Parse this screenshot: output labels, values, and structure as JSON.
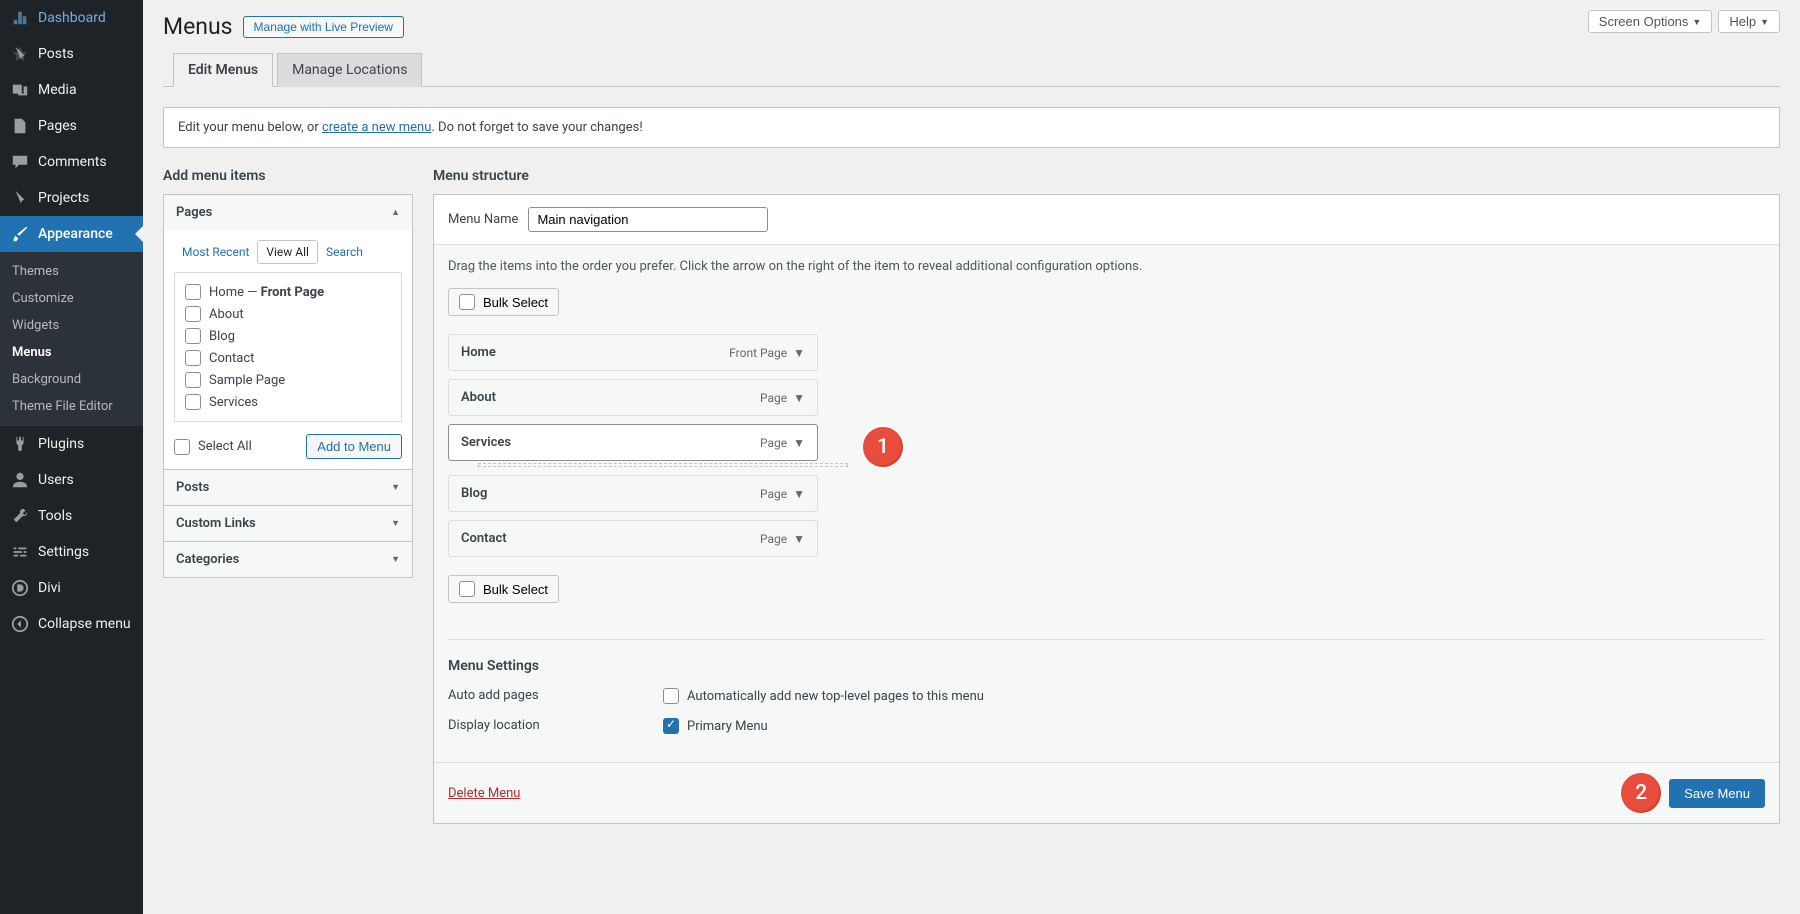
{
  "topControls": {
    "screenOptions": "Screen Options",
    "help": "Help"
  },
  "pageTitle": "Menus",
  "livePreviewBtn": "Manage with Live Preview",
  "tabs": {
    "editMenus": "Edit Menus",
    "manageLocations": "Manage Locations"
  },
  "infoBar": {
    "prefix": "Edit your menu below, or ",
    "link": "create a new menu",
    "suffix": ". Do not forget to save your changes!"
  },
  "sidebar": {
    "items": [
      {
        "label": "Dashboard"
      },
      {
        "label": "Posts"
      },
      {
        "label": "Media"
      },
      {
        "label": "Pages"
      },
      {
        "label": "Comments"
      },
      {
        "label": "Projects"
      },
      {
        "label": "Appearance"
      },
      {
        "label": "Plugins"
      },
      {
        "label": "Users"
      },
      {
        "label": "Tools"
      },
      {
        "label": "Settings"
      },
      {
        "label": "Divi"
      },
      {
        "label": "Collapse menu"
      }
    ],
    "submenu": {
      "themes": "Themes",
      "customize": "Customize",
      "widgets": "Widgets",
      "menus": "Menus",
      "background": "Background",
      "themeFileEditor": "Theme File Editor"
    }
  },
  "leftCol": {
    "title": "Add menu items",
    "pagesHeader": "Pages",
    "innerTabs": {
      "mostRecent": "Most Recent",
      "viewAll": "View All",
      "search": "Search"
    },
    "pagesList": {
      "home": "Home — ",
      "homeSuffix": "Front Page",
      "about": "About",
      "blog": "Blog",
      "contact": "Contact",
      "sample": "Sample Page",
      "services": "Services"
    },
    "selectAll": "Select All",
    "addToMenu": "Add to Menu",
    "postsHeader": "Posts",
    "customLinksHeader": "Custom Links",
    "categoriesHeader": "Categories"
  },
  "rightCol": {
    "title": "Menu structure",
    "menuNameLabel": "Menu Name",
    "menuNameValue": "Main navigation",
    "hint": "Drag the items into the order you prefer. Click the arrow on the right of the item to reveal additional configuration options.",
    "bulkSelect": "Bulk Select",
    "items": {
      "home": {
        "label": "Home",
        "type": "Front Page"
      },
      "about": {
        "label": "About",
        "type": "Page"
      },
      "services": {
        "label": "Services",
        "type": "Page"
      },
      "blog": {
        "label": "Blog",
        "type": "Page"
      },
      "contact": {
        "label": "Contact",
        "type": "Page"
      }
    },
    "settings": {
      "title": "Menu Settings",
      "autoAddLabel": "Auto add pages",
      "autoAddOption": "Automatically add new top-level pages to this menu",
      "displayLocationLabel": "Display location",
      "primaryMenu": "Primary Menu"
    },
    "deleteMenu": "Delete Menu",
    "saveMenu": "Save Menu"
  },
  "callouts": {
    "one": "1",
    "two": "2"
  }
}
